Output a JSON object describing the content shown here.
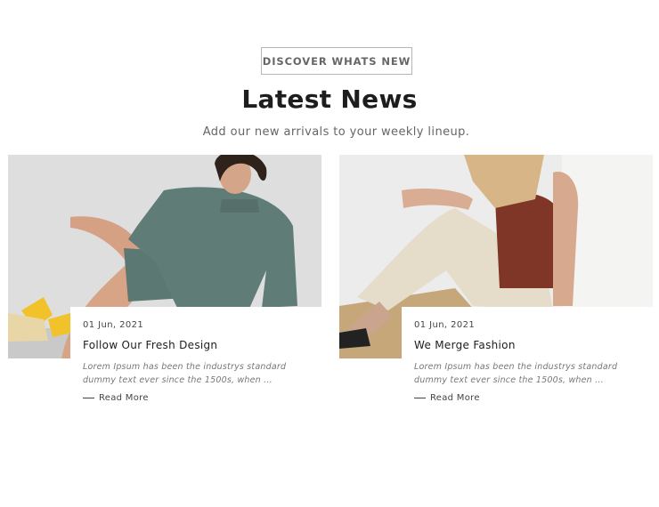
{
  "section": {
    "eyebrow": "DISCOVER WHATS NEW",
    "title": "Latest News",
    "subtitle": "Add our new arrivals to your weekly lineup."
  },
  "posts": [
    {
      "date": "01 Jun, 2021",
      "title": "Follow Our Fresh Design",
      "excerpt": "Lorem Ipsum has been the industrys standard dummy text ever since the 1500s, when ...",
      "read_more": "Read More",
      "image": "woman-green-sweatshirt-photo"
    },
    {
      "date": "01 Jun, 2021",
      "title": "We Merge Fashion",
      "excerpt": "Lorem Ipsum has been the industrys standard dummy text ever since the 1500s, when ...",
      "read_more": "Read More",
      "image": "woman-rust-tank-top-photo"
    }
  ]
}
